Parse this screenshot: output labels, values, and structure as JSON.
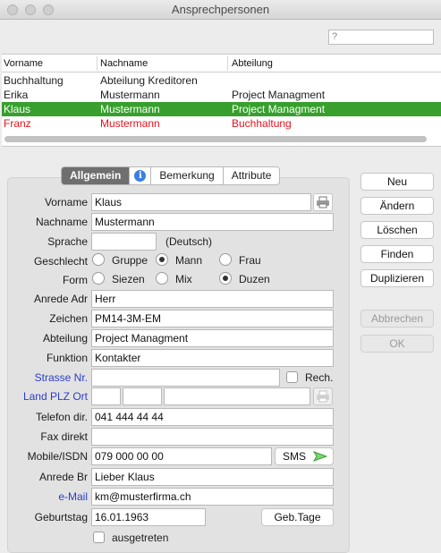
{
  "window": {
    "title": "Ansprechpersonen"
  },
  "search": {
    "value": "?"
  },
  "grid": {
    "columns": [
      "Vorname",
      "Nachname",
      "Abteilung"
    ],
    "rows": [
      [
        "Buchhaltung",
        "Abteilung Kreditoren",
        ""
      ],
      [
        "Erika",
        "Mustermann",
        "Project Managment"
      ],
      [
        "Klaus",
        "Mustermann",
        "Project Managment"
      ],
      [
        "Franz",
        "Mustermann",
        "Buchhaltung"
      ]
    ],
    "selected_row": 2,
    "highlight_row_color": "#37a02c",
    "red_row": 3,
    "red_color": "#e0141e"
  },
  "tabs": {
    "allgemein": "Allgemein",
    "bemerkung": "Bemerkung",
    "attribute": "Attribute"
  },
  "form": {
    "vorname_label": "Vorname",
    "vorname": "Klaus",
    "nachname_label": "Nachname",
    "nachname": "Mustermann",
    "sprache_label": "Sprache",
    "sprache": "",
    "sprache_hint": "(Deutsch)",
    "geschlecht_label": "Geschlecht",
    "geschlecht_options": [
      "Gruppe",
      "Mann",
      "Frau"
    ],
    "geschlecht_selected": "Mann",
    "form_label": "Form",
    "form_options": [
      "Siezen",
      "Mix",
      "Duzen"
    ],
    "form_selected": "Duzen",
    "anrede_adr_label": "Anrede Adr",
    "anrede_adr": "Herr",
    "zeichen_label": "Zeichen",
    "zeichen": "PM14-3M-EM",
    "abteilung_label": "Abteilung",
    "abteilung": "Project Managment",
    "funktion_label": "Funktion",
    "funktion": "Kontakter",
    "strasse_label": "Strasse Nr.",
    "strasse": "",
    "rech_label": "Rech.",
    "land_label": "Land PLZ Ort",
    "land": "",
    "plz": "",
    "ort": "",
    "telefon_label": "Telefon dir.",
    "telefon": "041 444 44 44",
    "fax_label": "Fax direkt",
    "fax": "",
    "mobile_label": "Mobile/ISDN",
    "mobile": "079 000 00 00",
    "sms_label": "SMS",
    "anrede_br_label": "Anrede Br",
    "anrede_br": "Lieber Klaus",
    "email_label": "e-Mail",
    "email": "km@musterfirma.ch",
    "geburtstag_label": "Geburtstag",
    "geburtstag": "16.01.1963",
    "gebtage_label": "Geb.Tage",
    "ausgetreten_label": "ausgetreten",
    "link_label_color": "#2b3ec8"
  },
  "actions": {
    "neu": "Neu",
    "aendern": "Ändern",
    "loeschen": "Löschen",
    "finden": "Finden",
    "duplizieren": "Duplizieren",
    "abbrechen": "Abbrechen",
    "ok": "OK"
  }
}
